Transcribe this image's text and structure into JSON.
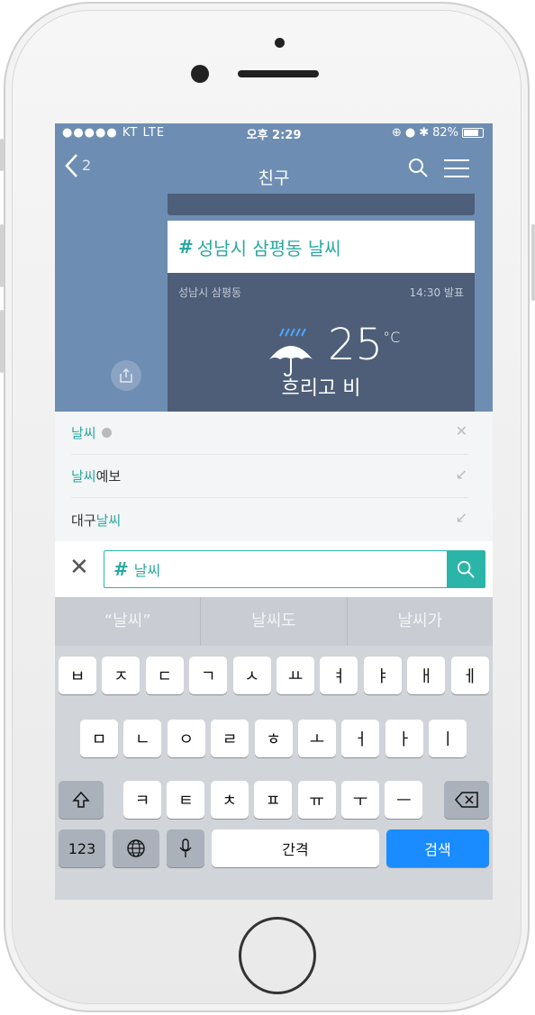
{
  "status": {
    "carrier": "●●●●● KT",
    "network": "LTE",
    "time": "오후 2:29",
    "battery": "82%",
    "battery_level": 0.82
  },
  "nav": {
    "back_count": "2",
    "title": "친구"
  },
  "card": {
    "hash": "#",
    "title": "성남시 삼평동 날씨",
    "location": "성남시 삼평동",
    "issued": "14:30 발표",
    "temp": "25",
    "unit": "°C",
    "condition": "흐리고 비"
  },
  "suggestions": [
    {
      "prefix": "",
      "highlight": "날씨",
      "suffix": "",
      "action_icon": "close-icon"
    },
    {
      "prefix": "",
      "highlight": "날씨",
      "suffix": "예보",
      "action_icon": "arrow-up-left-icon"
    },
    {
      "prefix": "대구 ",
      "highlight": "날씨",
      "suffix": "",
      "action_icon": "arrow-up-left-icon"
    }
  ],
  "search": {
    "hash": "#",
    "value": "날씨"
  },
  "predictions": [
    "“날씨”",
    "날씨도",
    "날씨가"
  ],
  "keyboard": {
    "row1": [
      "ㅂ",
      "ㅈ",
      "ㄷ",
      "ㄱ",
      "ㅅ",
      "ㅛ",
      "ㅕ",
      "ㅑ",
      "ㅐ",
      "ㅔ"
    ],
    "row2": [
      "ㅁ",
      "ㄴ",
      "ㅇ",
      "ㄹ",
      "ㅎ",
      "ㅗ",
      "ㅓ",
      "ㅏ",
      "ㅣ"
    ],
    "row3": [
      "ㅋ",
      "ㅌ",
      "ㅊ",
      "ㅍ",
      "ㅠ",
      "ㅜ",
      "ㅡ"
    ],
    "num_key": "123",
    "space": "간격",
    "search_key": "검색"
  },
  "colors": {
    "accent": "#2ab5a8",
    "nav_bg": "#6e8db2",
    "card_bg": "#4e5e78",
    "search_key": "#1a8cff"
  }
}
